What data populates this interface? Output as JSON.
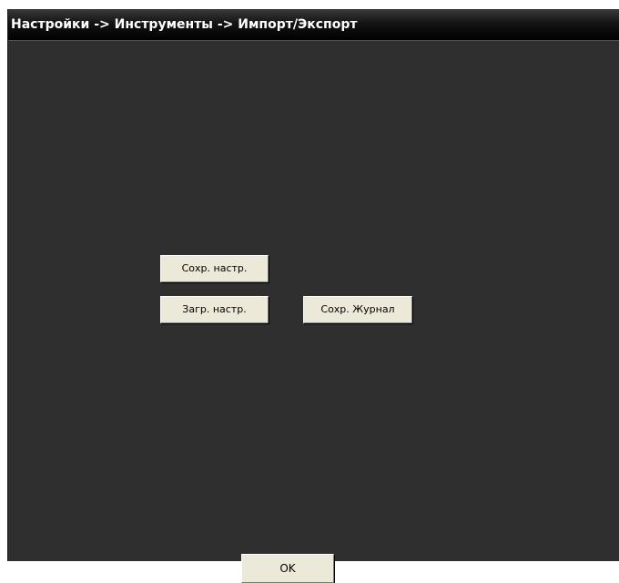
{
  "window": {
    "title": "Настройки -> Инструменты -> Импорт/Экспорт"
  },
  "buttons": {
    "save_settings": "Сохр. настр.",
    "load_settings": "Загр. настр.",
    "save_journal": "Сохр. Журнал",
    "ok": "OK"
  },
  "colors": {
    "background": "#2f2f2f",
    "titlebar": "#000000",
    "title_text": "#ffffff",
    "button_face": "#ece9d8"
  }
}
